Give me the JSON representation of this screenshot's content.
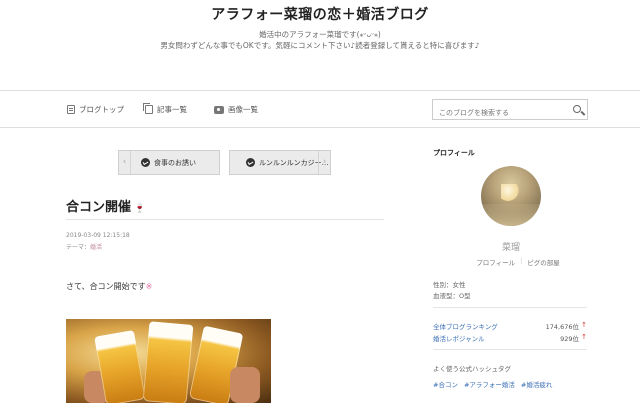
{
  "header": {
    "title": "アラフォー菜瑠の恋＋婚活ブログ",
    "desc_line1": "婚活中のアラフォー菜瑠です(⁎ᵕᴗᵕ⁎)",
    "desc_line2": "男女問わずどんな事でもOKです。気軽にコメント下さい♪読者登録して貰えると特に喜びます♪"
  },
  "nav": {
    "items": [
      {
        "label": "ブログトップ",
        "icon": "document-icon"
      },
      {
        "label": "記事一覧",
        "icon": "pages-icon"
      },
      {
        "label": "画像一覧",
        "icon": "camera-icon"
      }
    ],
    "search_placeholder": "このブログを検索する"
  },
  "pager": {
    "prev_label": "食事のお誘い",
    "next_label": "ルンルンルンカジー…"
  },
  "article": {
    "title": "合コン開催",
    "title_emoji": "🍷",
    "date": "2019-03-09 12:15:18",
    "theme_prefix": "テーマ：",
    "theme": "婚活",
    "body": "さて、合コン開始です",
    "body_emoji": "※"
  },
  "sidebar": {
    "profile_heading": "プロフィール",
    "name": "菜瑠",
    "link_profile": "プロフィール",
    "link_room": "ピグの部屋",
    "separator": "|",
    "gender": "性別：女性",
    "blood": "血液型：O型",
    "rankings": [
      {
        "label": "全体ブログランキング",
        "value": "174,676位",
        "arrow": "↑"
      },
      {
        "label": "婚活レポジャンル",
        "value": "929位",
        "arrow": "↑"
      }
    ],
    "hashtag_heading": "よく使う公式ハッシュタグ",
    "hashtags": [
      "#合コン",
      "#アラフォー婚活",
      "#婚活疲れ"
    ]
  },
  "colors": {
    "link": "#3b6fb5",
    "theme_link": "#c08a9a",
    "rank_arrow": "#d23c3c"
  }
}
